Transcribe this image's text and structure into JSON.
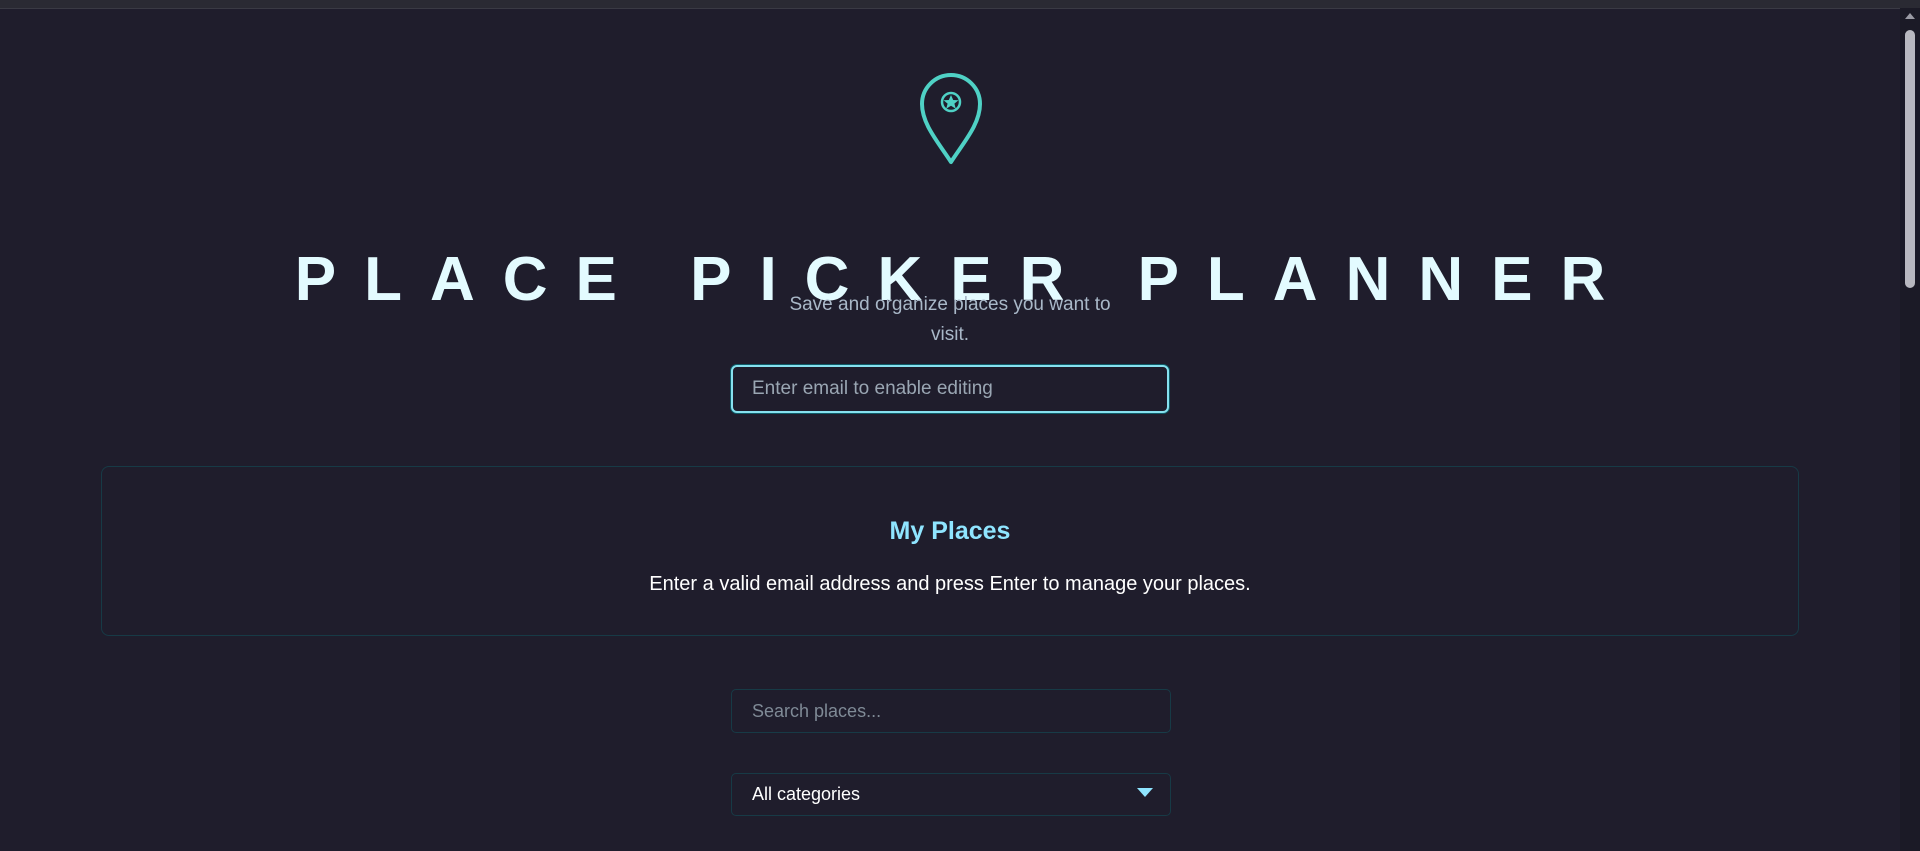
{
  "header": {
    "logo_icon": "map-pin-icon",
    "title": "PLACE PICKER PLANNER",
    "subtitle": "Save and organize places you want to visit."
  },
  "email": {
    "placeholder": "Enter email to enable editing",
    "value": ""
  },
  "places_panel": {
    "heading": "My Places",
    "message": "Enter a valid email address and press Enter to manage your places."
  },
  "search": {
    "placeholder": "Search places...",
    "value": ""
  },
  "category_filter": {
    "selected": "All categories",
    "arrow_icon": "chevron-down-icon"
  },
  "colors": {
    "background": "#1f1d2c",
    "accent": "#4fd1c5",
    "title": "#e3fbff",
    "heading": "#8fe5ff"
  }
}
